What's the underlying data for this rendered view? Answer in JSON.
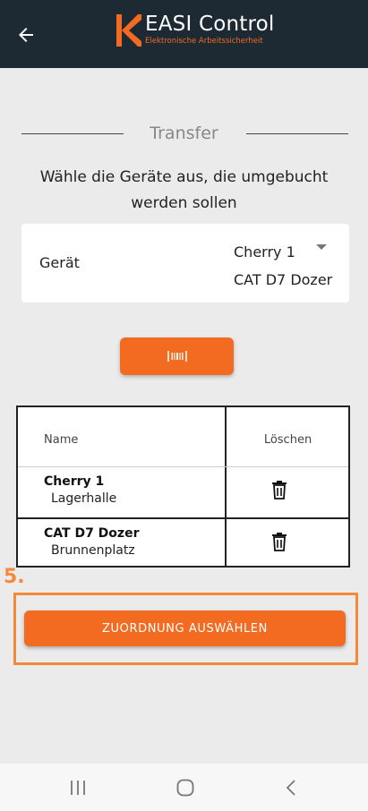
{
  "header": {
    "logo_title": "EASI Control",
    "logo_subtitle": "Elektronische Arbeitssicherheit",
    "background": "#1d2a33",
    "accent": "#f26b21"
  },
  "section": {
    "title": "Transfer"
  },
  "instructions": "Wähle die Geräte aus, die umgebucht werden sollen",
  "device_select": {
    "label": "Gerät",
    "selected": [
      "Cherry 1",
      "CAT D7 Dozer"
    ]
  },
  "scan_button": {
    "icon": "barcode-scan-icon"
  },
  "table": {
    "columns": [
      "Name",
      "Löschen"
    ],
    "rows": [
      {
        "name": "Cherry 1",
        "location": "Lagerhalle"
      },
      {
        "name": "CAT D7 Dozer",
        "location": "Brunnenplatz"
      }
    ]
  },
  "step_marker": "5.",
  "assign_button": {
    "label": "ZUORDNUNG AUSWÄHLEN"
  },
  "navbar": {
    "icons": [
      "recent-apps-icon",
      "home-icon",
      "back-nav-icon"
    ]
  }
}
